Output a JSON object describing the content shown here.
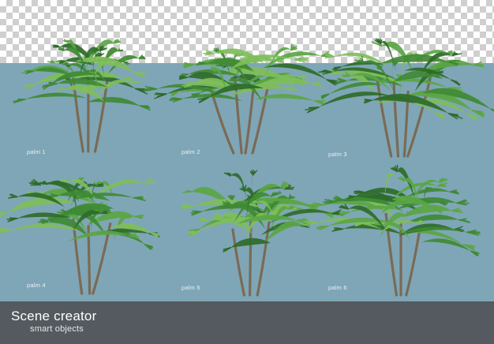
{
  "background_color": "#7fa6b6",
  "footer": {
    "title": "Scene creator",
    "subtitle": "smart objects",
    "color": "#545a5f"
  },
  "palms": [
    {
      "label": "palm 1"
    },
    {
      "label": "palm 2"
    },
    {
      "label": "palm 3"
    },
    {
      "label": "palm 4"
    },
    {
      "label": "palm 5"
    },
    {
      "label": "palm 6"
    }
  ],
  "leaf_colors": [
    "#2f6b2a",
    "#3f8a34",
    "#5aa643",
    "#7fbe5a"
  ],
  "trunk_color": "#7a6a55"
}
